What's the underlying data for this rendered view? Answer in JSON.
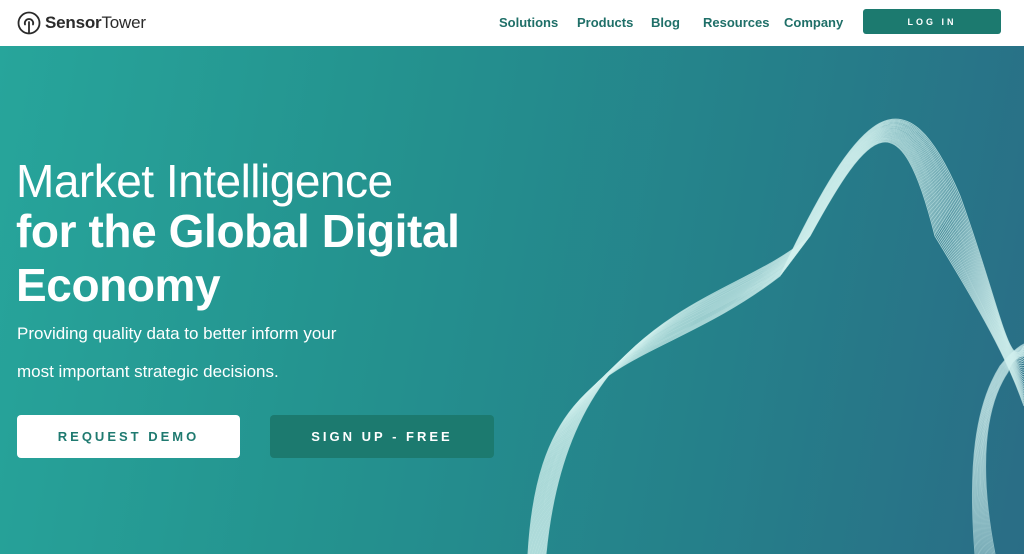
{
  "header": {
    "logo_bold": "Sensor",
    "logo_regular": "Tower",
    "nav": [
      {
        "label": "Solutions"
      },
      {
        "label": "Products"
      },
      {
        "label": "Blog"
      },
      {
        "label": "Resources"
      },
      {
        "label": "Company"
      }
    ],
    "login_label": "LOG IN"
  },
  "hero": {
    "title_light": "Market Intelligence",
    "title_bold_line1": "for the Global Digital",
    "title_bold_line2": "Economy",
    "subtitle_line1": "Providing quality data to better inform your",
    "subtitle_line2": "most important strategic decisions.",
    "cta_demo": "REQUEST DEMO",
    "cta_signup": "SIGN UP - FREE"
  },
  "colors": {
    "brand_teal": "#1c7a6f",
    "nav_text": "#1f6f68",
    "hero_start": "#27a59b",
    "hero_end": "#2a6d86"
  }
}
